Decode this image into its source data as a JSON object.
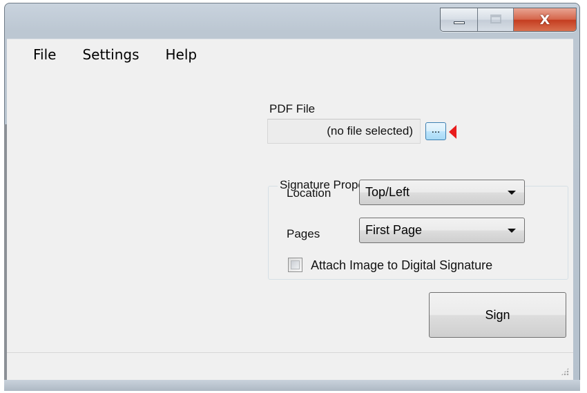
{
  "window": {
    "title": "",
    "caption_buttons": {
      "minimize": "minimize-icon",
      "maximize": "maximize-icon",
      "close_glyph": "X"
    }
  },
  "menu": {
    "items": [
      {
        "label": "File"
      },
      {
        "label": "Settings"
      },
      {
        "label": "Help"
      }
    ]
  },
  "pdf": {
    "label": "PDF File",
    "value": "(no file selected)",
    "browse_label": "..."
  },
  "signature_properties": {
    "title": "Signature Properties",
    "location": {
      "label": "Location",
      "selected": "Top/Left"
    },
    "pages": {
      "label": "Pages",
      "selected": "First Page"
    },
    "attach_image": {
      "label": "Attach Image to Digital Signature",
      "checked": false
    }
  },
  "actions": {
    "sign_label": "Sign"
  },
  "colors": {
    "annotation_marker": "#e81d1d",
    "client_background": "#f0f0f0",
    "close_button": "#c43c1f"
  }
}
